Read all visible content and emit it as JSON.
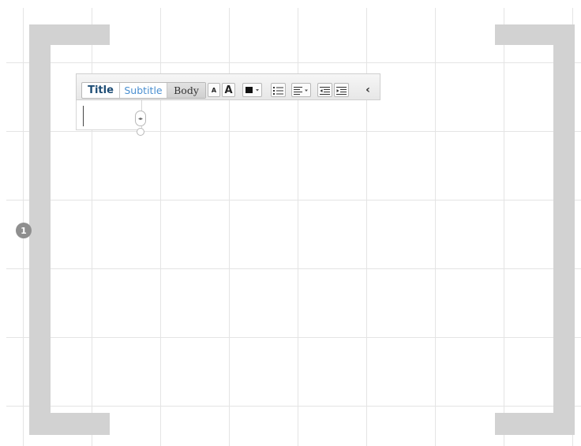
{
  "page": {
    "badge_number": "1"
  },
  "toolbar": {
    "styles": {
      "title": "Title",
      "subtitle": "Subtitle",
      "body": "Body",
      "selected": "Body"
    },
    "font_size_small": "A",
    "font_size_large": "A",
    "text_color": "#111111",
    "icons": {
      "color": "color-swatch-icon",
      "bullets": "bulleted-list-icon",
      "align": "align-left-icon",
      "outdent": "outdent-icon",
      "indent": "indent-icon",
      "collapse": "chevron-left-icon"
    },
    "collapse_glyph": "‹"
  },
  "colors": {
    "bracket": "#d2d2d2",
    "title_text": "#1e4d75",
    "subtitle_text": "#4a8fd0"
  }
}
